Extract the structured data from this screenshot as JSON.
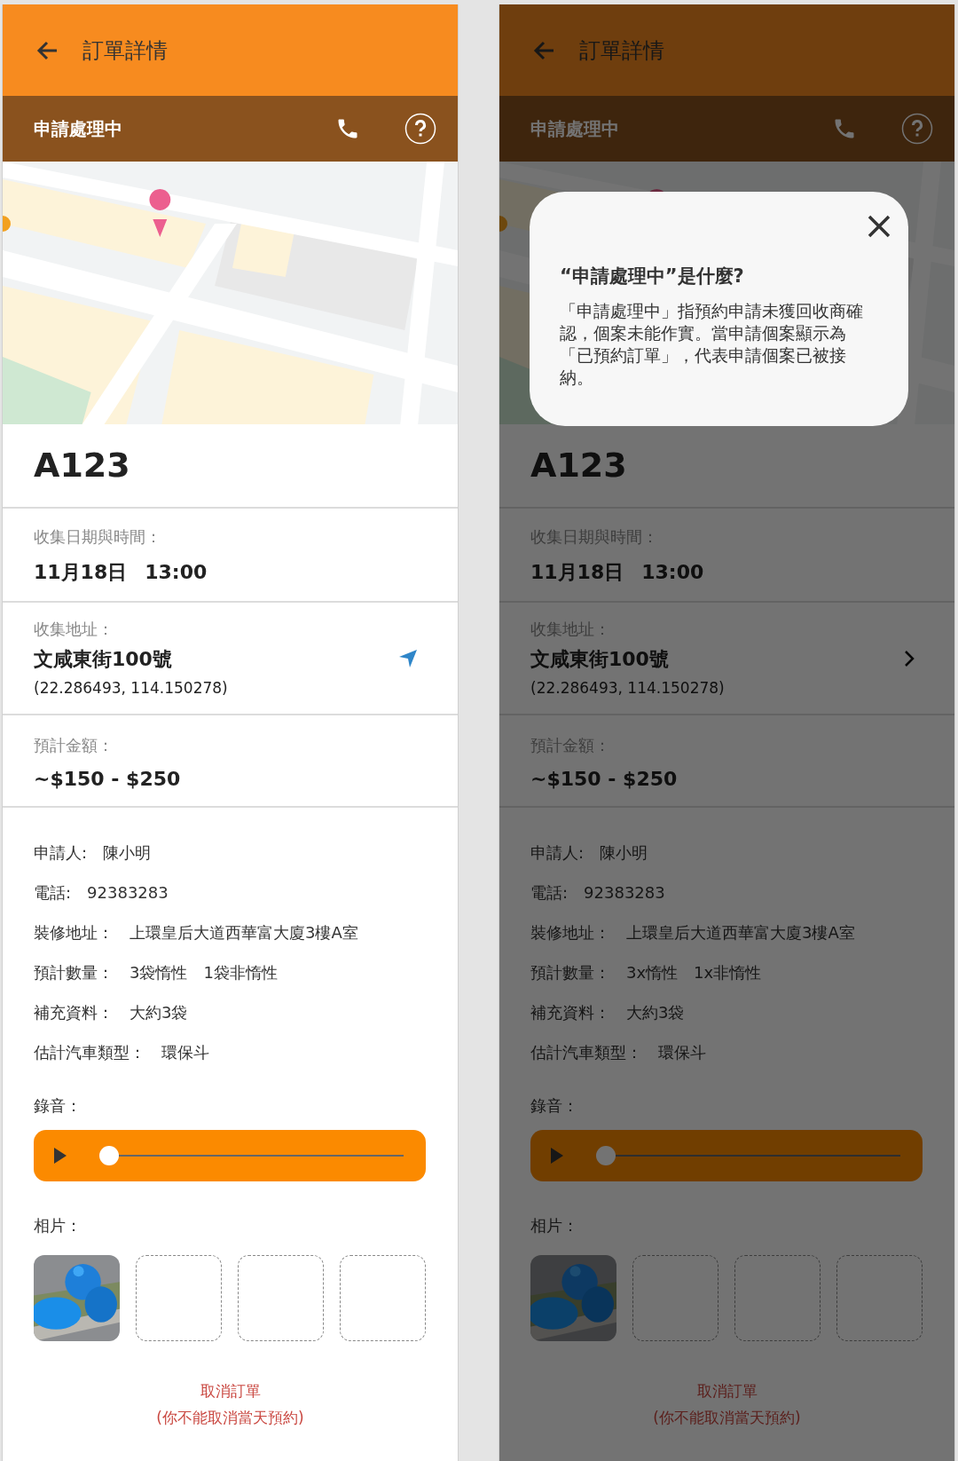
{
  "screens": [
    {
      "dimmed": false,
      "app_bar": {
        "title": "訂單詳情"
      },
      "status_bar": {
        "label": "申請處理中"
      },
      "map": {
        "kind": "picture"
      },
      "order_id": "A123",
      "collection_time": {
        "label": "收集日期與時間：",
        "date": "11月18日",
        "time": "13:00"
      },
      "address": {
        "label": "收集地址：",
        "value": "文咸東街100號",
        "coordinates": "(22.286493, 114.150278)",
        "action": {
          "kind": "navigate"
        }
      },
      "estimate": {
        "label": "預計金額：",
        "value": "~$150 - $250"
      },
      "details": [
        {
          "label": "申請人:",
          "values": [
            "陳小明"
          ]
        },
        {
          "label": "電話:",
          "values": [
            "92383283"
          ]
        },
        {
          "label": "裝修地址：",
          "values": [
            "上環皇后大道西華富大廈3樓A室"
          ]
        },
        {
          "label": "預計數量：",
          "values": [
            "3袋惰性",
            "1袋非惰性"
          ]
        },
        {
          "label": "補充資料：",
          "values": [
            "大約3袋"
          ]
        },
        {
          "label": "估計汽車類型：",
          "values": [
            "環保斗"
          ]
        }
      ],
      "recording": {
        "label": "錄音：",
        "level": 0
      },
      "photos": {
        "label": "相片：",
        "slots": [
          {
            "kind": "picture"
          },
          {
            "kind": "empty"
          },
          {
            "kind": "empty"
          },
          {
            "kind": "empty"
          }
        ]
      },
      "cancel": {
        "label": "取消訂單",
        "note": "(你不能取消當天預約)"
      }
    },
    {
      "dimmed": true,
      "app_bar": {
        "title": "訂單詳情"
      },
      "status_bar": {
        "label": "申請處理中"
      },
      "map": {
        "kind": "picture"
      },
      "order_id": "A123",
      "collection_time": {
        "label": "收集日期與時間：",
        "date": "11月18日",
        "time": "13:00"
      },
      "address": {
        "label": "收集地址：",
        "value": "文咸東街100號",
        "coordinates": "(22.286493, 114.150278)",
        "action": {
          "kind": "detail"
        }
      },
      "estimate": {
        "label": "預計金額：",
        "value": "~$150 - $250"
      },
      "details": [
        {
          "label": "申請人:",
          "values": [
            "陳小明"
          ]
        },
        {
          "label": "電話:",
          "values": [
            "92383283"
          ]
        },
        {
          "label": "裝修地址：",
          "values": [
            "上環皇后大道西華富大廈3樓A室"
          ]
        },
        {
          "label": "預計數量：",
          "values": [
            "3x惰性",
            "1x非惰性"
          ]
        },
        {
          "label": "補充資料：",
          "values": [
            "大約3袋"
          ]
        },
        {
          "label": "估計汽車類型：",
          "values": [
            "環保斗"
          ]
        }
      ],
      "recording": {
        "label": "錄音：",
        "level": 0
      },
      "photos": {
        "label": "相片：",
        "slots": [
          {
            "kind": "picture"
          },
          {
            "kind": "empty"
          },
          {
            "kind": "empty"
          },
          {
            "kind": "empty"
          }
        ]
      },
      "cancel": {
        "label": "取消訂單",
        "note": "(你不能取消當天預約)"
      },
      "dialog": {
        "title": "“申請處理中”是什麼?",
        "body": "「申請處理中」指預約申請未獲回收商確認，個案未能作實。當申請個案顯示為「已預約訂單」，代表申請個案已被接納。"
      }
    }
  ]
}
